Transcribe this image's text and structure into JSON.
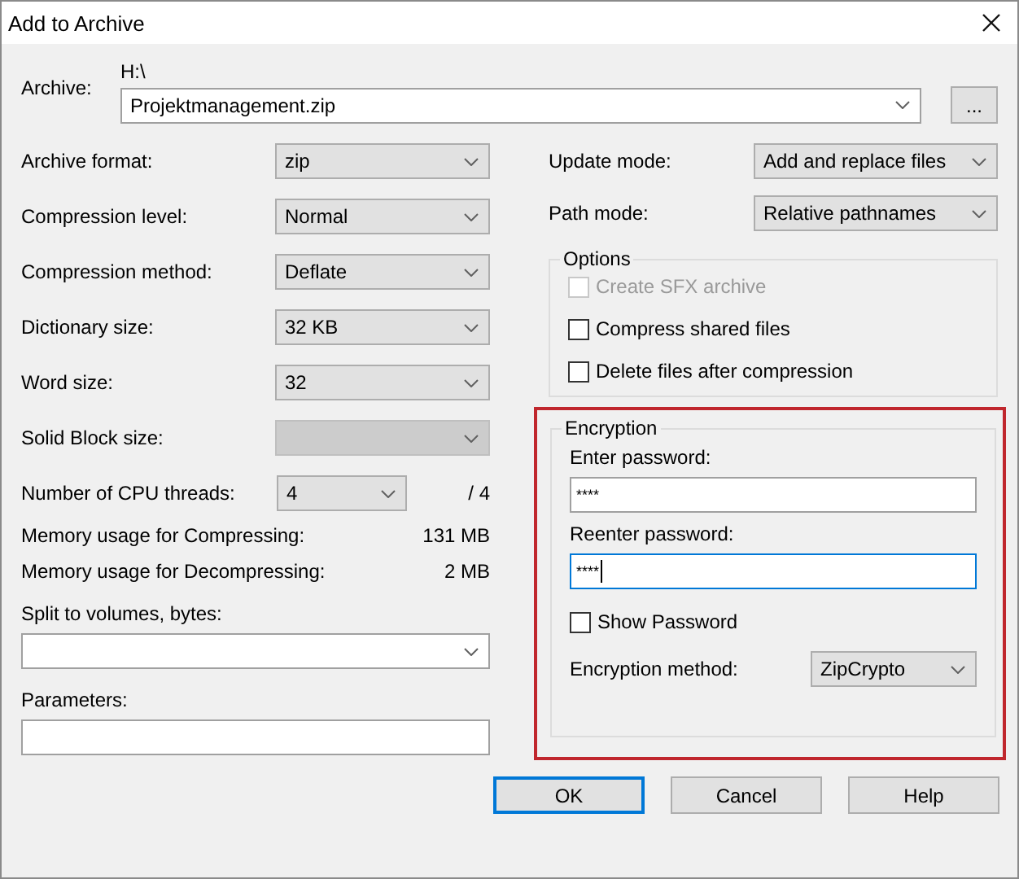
{
  "window": {
    "title": "Add to Archive"
  },
  "archive": {
    "label": "Archive:",
    "folder": "H:\\",
    "value": "Projektmanagement.zip",
    "browse": "..."
  },
  "left_rows": [
    {
      "kind": "combo",
      "label": "Archive format:",
      "value": "zip",
      "disabled": false
    },
    {
      "kind": "combo",
      "label": "Compression level:",
      "value": "Normal",
      "disabled": false
    },
    {
      "kind": "combo",
      "label": "Compression method:",
      "value": "Deflate",
      "disabled": false
    },
    {
      "kind": "combo",
      "label": "Dictionary size:",
      "value": "32 KB",
      "disabled": false
    },
    {
      "kind": "combo",
      "label": "Word size:",
      "value": "32",
      "disabled": false
    },
    {
      "kind": "combo",
      "label": "Solid Block size:",
      "disabled": true
    },
    {
      "kind": "threads",
      "label": "Number of CPU threads:",
      "value": "4",
      "suffix": "/ 4",
      "disabled": false
    },
    {
      "kind": "info",
      "label": "Memory usage for Compressing:",
      "value": "131 MB"
    },
    {
      "kind": "info",
      "label": "Memory usage for Decompressing:",
      "value": "2 MB"
    },
    {
      "kind": "editable",
      "label": "Split to volumes, bytes:"
    },
    {
      "kind": "text",
      "label": "Parameters:"
    }
  ],
  "right_rows": [
    {
      "label": "Update mode:",
      "value": "Add and replace files"
    },
    {
      "label": "Path mode:",
      "value": "Relative pathnames"
    }
  ],
  "options": {
    "title": "Options",
    "items": [
      {
        "label": "Create SFX archive",
        "checked": false,
        "disabled": true
      },
      {
        "label": "Compress shared files",
        "checked": false,
        "disabled": false
      },
      {
        "label": "Delete files after compression",
        "checked": false,
        "disabled": false
      }
    ]
  },
  "encryption": {
    "title": "Encryption",
    "highlighted": true,
    "passwords": [
      {
        "label": "Enter password:",
        "value": "****",
        "focused": false
      },
      {
        "label": "Reenter password:",
        "value": "****",
        "focused": true
      }
    ],
    "show_password": {
      "label": "Show Password",
      "checked": false
    },
    "method": {
      "label": "Encryption method:",
      "value": "ZipCrypto"
    }
  },
  "buttons": [
    {
      "label": "OK",
      "default": true
    },
    {
      "label": "Cancel",
      "default": false
    },
    {
      "label": "Help",
      "default": false
    }
  ]
}
